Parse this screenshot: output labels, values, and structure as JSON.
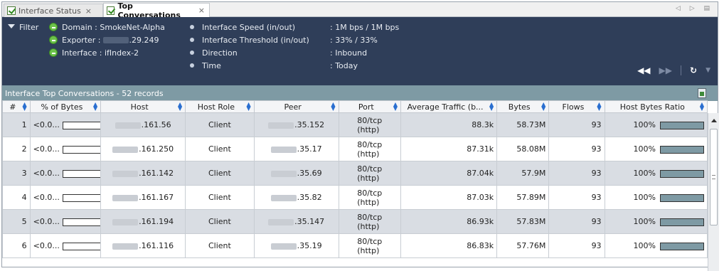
{
  "tabs": [
    {
      "label": "Interface Status",
      "active": false
    },
    {
      "label": "Top Conversations",
      "active": true
    }
  ],
  "tab_close_glyph": "×",
  "tabbar_controls": "◁ ▷ ▤",
  "info": {
    "filter_label": "Filter",
    "domain": "Domain   : SmokeNet-Alpha",
    "exporter_prefix": "Exporter   :",
    "exporter_suffix": ".29.249",
    "interface": "Interface : ifIndex-2",
    "speed_label": "Interface Speed (in/out)",
    "speed_value": ": 1M bps / 1M bps",
    "threshold_label": "Interface Threshold (in/out)",
    "threshold_value": ": 33% / 33%",
    "direction_label": "Direction",
    "direction_value": ": Inbound",
    "time_label": "Time",
    "time_value": ": Today"
  },
  "grid_title": "Interface Top Conversations - 52 records",
  "columns": [
    "#",
    "% of Bytes",
    "Host",
    "Host Role",
    "Peer",
    "Port",
    "Average Traffic (b...",
    "Bytes",
    "Flows",
    "Host Bytes Ratio"
  ],
  "rows": [
    {
      "num": "1",
      "pct": "<0.0...",
      "host": ".161.56",
      "role": "Client",
      "peer": ".35.152",
      "port1": "80/tcp",
      "port2": "(http)",
      "avg": "88.3k",
      "bytes": "58.73M",
      "flows": "93",
      "ratio": "100%",
      "ratio_fill": 1.0
    },
    {
      "num": "2",
      "pct": "<0.0...",
      "host": ".161.250",
      "role": "Client",
      "peer": ".35.17",
      "port1": "80/tcp",
      "port2": "(http)",
      "avg": "87.31k",
      "bytes": "58.08M",
      "flows": "93",
      "ratio": "100%",
      "ratio_fill": 1.0
    },
    {
      "num": "3",
      "pct": "<0.0...",
      "host": ".161.142",
      "role": "Client",
      "peer": ".35.69",
      "port1": "80/tcp",
      "port2": "(http)",
      "avg": "87.04k",
      "bytes": "57.9M",
      "flows": "93",
      "ratio": "100%",
      "ratio_fill": 1.0
    },
    {
      "num": "4",
      "pct": "<0.0...",
      "host": ".161.167",
      "role": "Client",
      "peer": ".35.82",
      "port1": "80/tcp",
      "port2": "(http)",
      "avg": "87.03k",
      "bytes": "57.89M",
      "flows": "93",
      "ratio": "100%",
      "ratio_fill": 1.0
    },
    {
      "num": "5",
      "pct": "<0.0...",
      "host": ".161.194",
      "role": "Client",
      "peer": ".35.147",
      "port1": "80/tcp",
      "port2": "(http)",
      "avg": "86.93k",
      "bytes": "57.83M",
      "flows": "93",
      "ratio": "100%",
      "ratio_fill": 1.0
    },
    {
      "num": "6",
      "pct": "<0.0...",
      "host": ".161.116",
      "role": "Client",
      "peer": ".35.19",
      "port1": "80/tcp",
      "port2": "(http)",
      "avg": "86.83k",
      "bytes": "57.76M",
      "flows": "93",
      "ratio": "100%",
      "ratio_fill": 1.0
    }
  ],
  "colors": {
    "info_bg": "#2f3e59",
    "grid_title_bg": "#7e9aa4",
    "row_alt_bg": "#d9dde3",
    "ratio_fill": "#7e9aa4",
    "status_icon": "#6cc24a"
  }
}
